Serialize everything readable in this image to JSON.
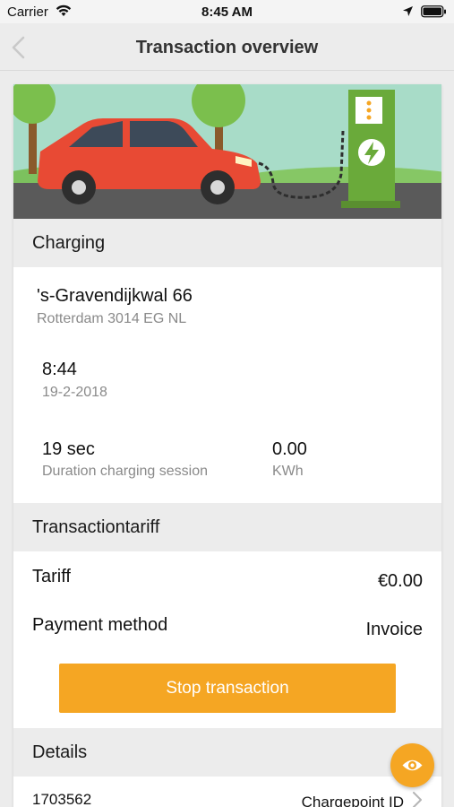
{
  "status_bar": {
    "carrier": "Carrier",
    "time": "8:45 AM",
    "wifi_icon": "wifi-icon",
    "location_icon": "location-arrow-icon",
    "battery_icon": "battery-icon"
  },
  "nav": {
    "title": "Transaction overview",
    "back_icon": "chevron-left-icon"
  },
  "charging": {
    "header": "Charging",
    "address_street": "'s-Gravendijkwal 66",
    "address_city": "Rotterdam 3014 EG NL",
    "time": "8:44",
    "date": "19-2-2018",
    "duration_value": "19 sec",
    "duration_label": "Duration charging session",
    "energy_value": "0.00",
    "energy_unit": "KWh"
  },
  "tariff": {
    "header": "Transactiontariff",
    "tariff_label": "Tariff",
    "tariff_value": "€0.00",
    "payment_label": "Payment method",
    "payment_value": "Invoice",
    "stop_button": "Stop transaction"
  },
  "details": {
    "header": "Details",
    "id_value": "1703562",
    "id_label": "Chargepoint ID",
    "chevron_icon": "chevron-right-icon"
  },
  "fab_icon": "eye-icon",
  "colors": {
    "accent": "#f5a623",
    "section_bg": "#ececec",
    "card_bg": "#ffffff",
    "secondary_text": "#8a8a8a",
    "charger_green": "#6aaa3a",
    "car_red": "#e84a34"
  }
}
